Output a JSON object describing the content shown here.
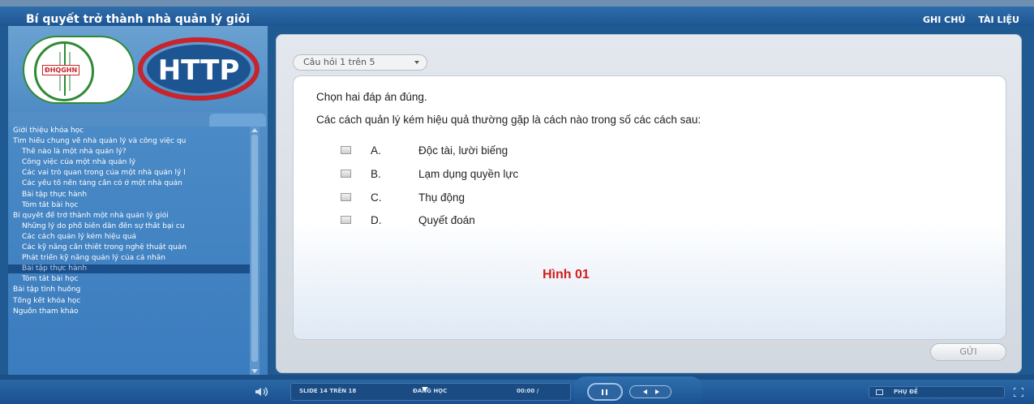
{
  "header": {
    "title": "Bí quyết trở thành nhà quản lý giỏi",
    "links": [
      "GHI CHÚ",
      "TÀI LIỆU"
    ]
  },
  "sidebar": {
    "logo_left_text": "ĐHQGHN",
    "logo_right_text": "HTTP",
    "items": [
      {
        "label": "Giới thiệu khóa học",
        "level": 1
      },
      {
        "label": "Tìm hiểu chung về nhà quản lý và công việc qu",
        "level": 1
      },
      {
        "label": "Thế nào là một nhà quản lý?",
        "level": 2
      },
      {
        "label": "Công việc của một nhà quản lý",
        "level": 2
      },
      {
        "label": "Các vai trò quan trong của một nhà quản lý l",
        "level": 2
      },
      {
        "label": "Các yếu tố nền tảng cần có ở một nhà quản",
        "level": 2
      },
      {
        "label": "Bài tập thực hành",
        "level": 2
      },
      {
        "label": "Tóm tắt bài học",
        "level": 2
      },
      {
        "label": "Bí quyết để trở thành một nhà quản lý giỏi",
        "level": 1
      },
      {
        "label": "Những lý do phổ biến dẫn đến sự thất bại cu",
        "level": 2
      },
      {
        "label": "Các cách quản lý kém hiệu quả",
        "level": 2
      },
      {
        "label": "Các kỹ năng cần thiết trong nghệ thuật quản",
        "level": 2
      },
      {
        "label": "Phát triển kỹ năng quản lý của cá nhân",
        "level": 2
      },
      {
        "label": "Bài tập thực hành",
        "level": 2,
        "active": true
      },
      {
        "label": "Tóm tắt bài học",
        "level": 2
      },
      {
        "label": "Bài tập tình huống",
        "level": 1
      },
      {
        "label": "Tổng kết khóa học",
        "level": 1
      },
      {
        "label": "Nguồn tham khảo",
        "level": 1
      }
    ]
  },
  "quiz": {
    "question_selector": "Câu hỏi 1 trên 5",
    "instruction": "Chọn hai đáp án đúng.",
    "question": "Các cách quản lý kém hiệu quả thường gặp là cách nào trong số các cách sau:",
    "options": [
      {
        "letter": "A.",
        "text": "Độc tài, lười biếng"
      },
      {
        "letter": "B.",
        "text": "Lạm dụng quyền lực"
      },
      {
        "letter": "C.",
        "text": "Thụ động"
      },
      {
        "letter": "D.",
        "text": "Quyết đoán"
      }
    ],
    "figure_label": "Hình 01",
    "submit_label": "GỬI"
  },
  "player": {
    "slide_info": "SLIDE 14 TRÊN 18",
    "status": "ĐANG HỌC",
    "time": "00:00 /",
    "subtitle_label": "PHỤ ĐỀ"
  },
  "icons": {
    "volume": "volume-icon",
    "pause": "pause-icon",
    "prev": "prev-icon",
    "next": "next-icon",
    "subtitle": "subtitle-icon",
    "fullscreen": "fullscreen-icon"
  },
  "colors": {
    "brand_blue": "#1d5592",
    "figure_label_red": "#d11d1d",
    "logo_green": "#2e8a35",
    "logo_red": "#c8242b",
    "active_item": "#1b4f8a"
  }
}
